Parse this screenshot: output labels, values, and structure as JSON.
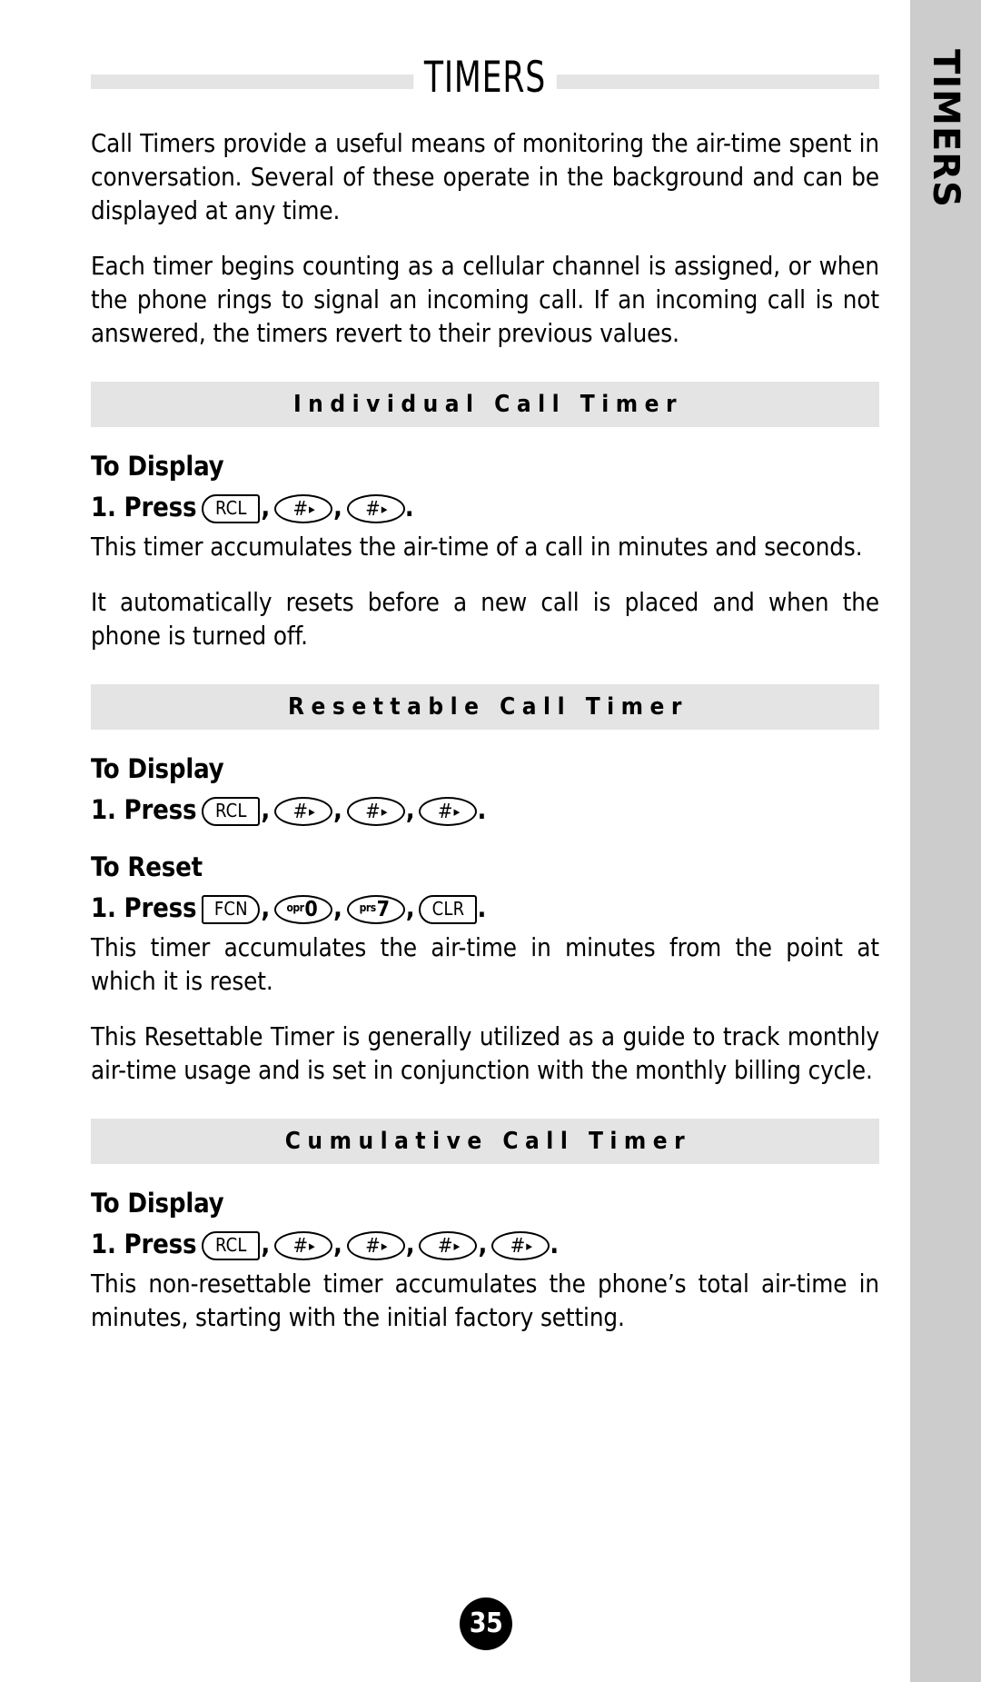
{
  "document": {
    "title": "TIMERS",
    "page_number": "35",
    "side_tab_label": "TIMERS"
  },
  "intro": {
    "paragraph_1": "Call Timers provide a useful means of monitoring the air-time spent in conversation. Several of these operate in the background and can be displayed at any time.",
    "paragraph_2": "Each timer begins counting as a cellular channel is assigned, or when the phone rings to signal an incoming call. If an incoming call is not answered, the timers revert to their previous values."
  },
  "sections": [
    {
      "heading": "Individual Call Timer",
      "subhead_display": "To Display",
      "press_label": "1. Press",
      "keys_display": [
        {
          "type": "rcl",
          "label": "RCL"
        },
        {
          "type": "hash",
          "label": "#"
        },
        {
          "type": "hash",
          "label": "#"
        }
      ],
      "paragraph_1": "This timer accumulates the air-time of a call in minutes and seconds.",
      "paragraph_2": "It automatically resets before a new call is placed and when the phone is turned off."
    },
    {
      "heading": "Resettable Call Timer",
      "subhead_display": "To Display",
      "press_label": "1. Press",
      "keys_display": [
        {
          "type": "rcl",
          "label": "RCL"
        },
        {
          "type": "hash",
          "label": "#"
        },
        {
          "type": "hash",
          "label": "#"
        },
        {
          "type": "hash",
          "label": "#"
        }
      ],
      "subhead_reset": "To Reset",
      "press_label_reset": "1. Press",
      "keys_reset": [
        {
          "type": "fcn",
          "label": "FCN"
        },
        {
          "type": "digit",
          "sup": "opr",
          "label": "0"
        },
        {
          "type": "digit",
          "sup": "prs",
          "label": "7"
        },
        {
          "type": "rcl",
          "label": "CLR"
        }
      ],
      "paragraph_1": "This timer accumulates the air-time in minutes from the point at which it is reset.",
      "paragraph_2": "This Resettable Timer is generally utilized as a guide to track monthly air-time usage and is set in conjunction with the monthly billing cycle."
    },
    {
      "heading": "Cumulative Call Timer",
      "subhead_display": "To Display",
      "press_label": "1. Press",
      "keys_display": [
        {
          "type": "rcl",
          "label": "RCL"
        },
        {
          "type": "hash",
          "label": "#"
        },
        {
          "type": "hash",
          "label": "#"
        },
        {
          "type": "hash",
          "label": "#"
        },
        {
          "type": "hash",
          "label": "#"
        }
      ],
      "paragraph_1": "This non-resettable timer accumulates the phone’s total air-time in minutes, starting with the initial factory setting."
    }
  ],
  "punctuation": {
    "comma": ",",
    "period": "."
  },
  "colors": {
    "band": "#e4e4e4",
    "tab": "#cccccc",
    "ink": "#000000",
    "paper": "#ffffff"
  }
}
